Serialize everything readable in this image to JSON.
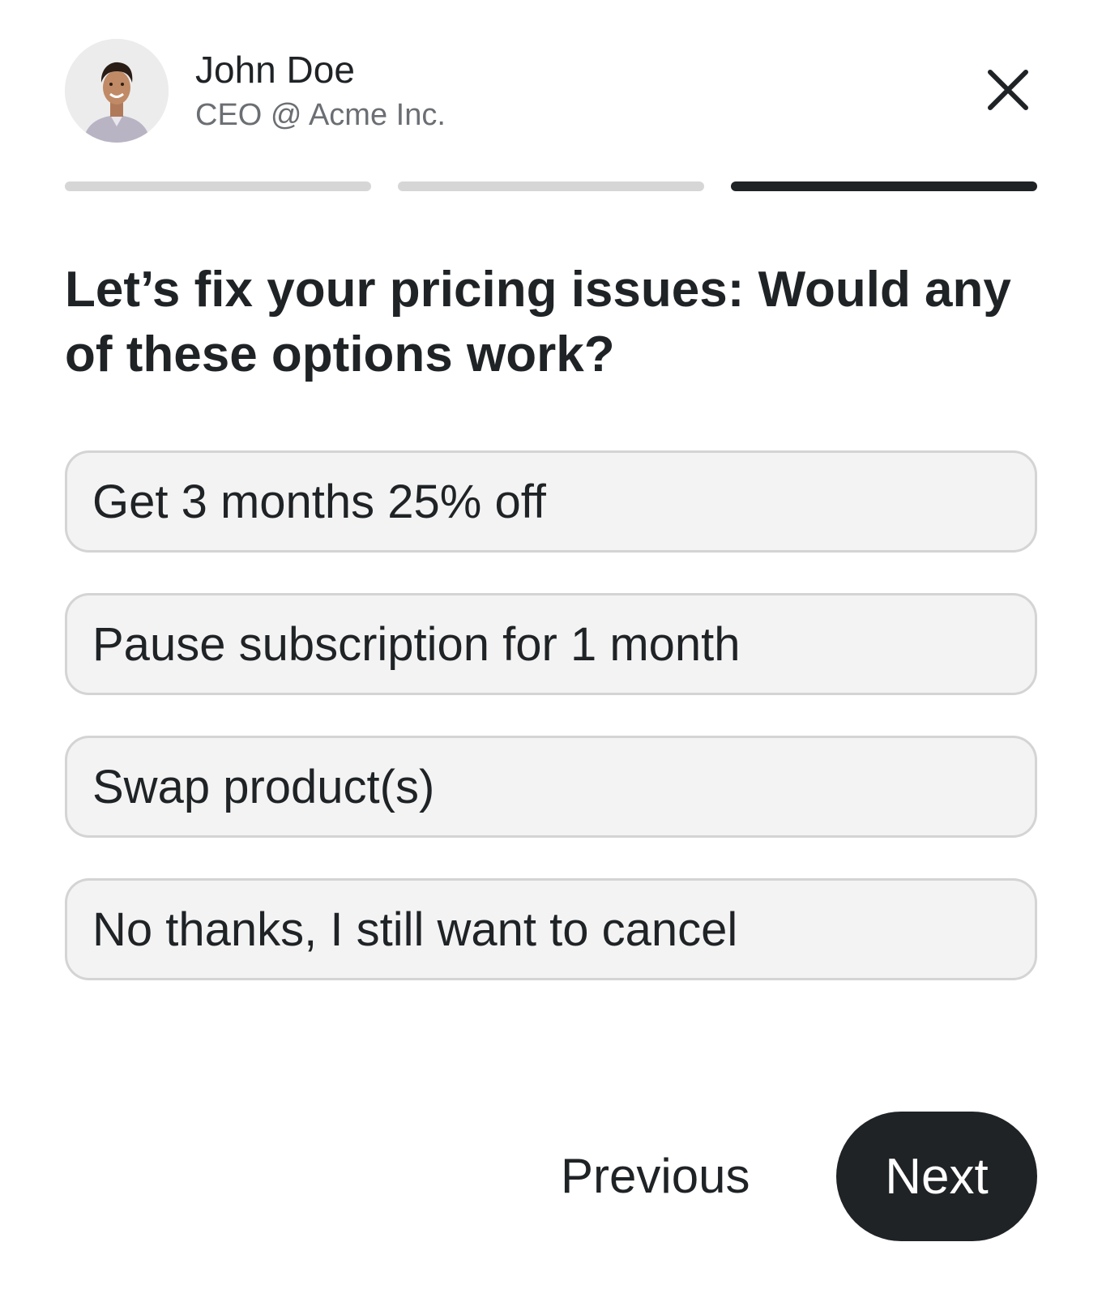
{
  "profile": {
    "name": "John Doe",
    "role": "CEO @ Acme Inc.",
    "avatar_icon": "person-photo"
  },
  "close": {
    "icon": "close-icon"
  },
  "progress": {
    "total_steps": 3,
    "current_step": 3
  },
  "question": {
    "text": "Let’s fix your pricing issues: Would any of these options work?"
  },
  "options": [
    {
      "label": "Get 3 months 25% off"
    },
    {
      "label": "Pause subscription for 1 month"
    },
    {
      "label": "Swap product(s)"
    },
    {
      "label": "No thanks, I still want to cancel"
    }
  ],
  "footer": {
    "previous_label": "Previous",
    "next_label": "Next"
  },
  "colors": {
    "text": "#1f2326",
    "muted_text": "#6b6f73",
    "option_bg": "#f3f3f3",
    "option_border": "#d4d4d4",
    "progress_inactive": "#d6d6d6",
    "progress_active": "#1f2326",
    "next_bg": "#1f2326"
  }
}
